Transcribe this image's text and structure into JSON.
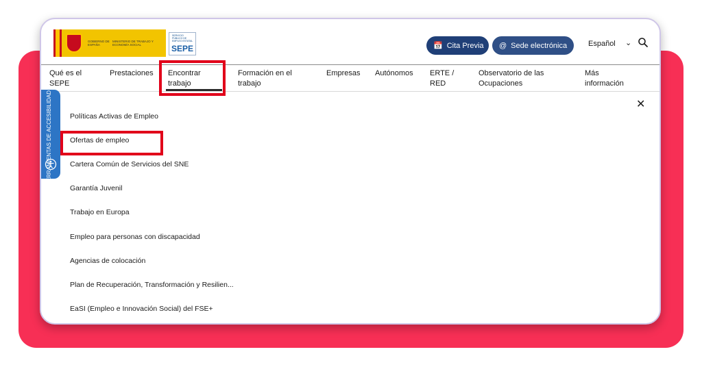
{
  "header": {
    "gov_text": "GOBIERNO DE ESPAÑA",
    "ministry_text": "MINISTERIO DE TRABAJO Y ECONOMÍA SOCIAL",
    "sepe_small": "SERVICIO PÚBLICO DE EMPLEO ESTATAL",
    "sepe_mark": "SEPE",
    "cita_label": "Cita Previa",
    "sede_label": "Sede electrónica",
    "language": "Español"
  },
  "nav": {
    "items": [
      {
        "line1": "Qué es el",
        "line2": "SEPE"
      },
      {
        "line1": "Prestaciones",
        "line2": ""
      },
      {
        "line1": "Encontrar",
        "line2": "trabajo"
      },
      {
        "line1": "Formación en el",
        "line2": "trabajo"
      },
      {
        "line1": "Empresas",
        "line2": ""
      },
      {
        "line1": "Autónomos",
        "line2": ""
      },
      {
        "line1": "ERTE /",
        "line2": "RED"
      },
      {
        "line1": "Observatorio de las",
        "line2": "Ocupaciones"
      },
      {
        "line1": "Más",
        "line2": "información"
      }
    ]
  },
  "accessibility_label": "HERRAMIENTAS DE ACCESIBILIDAD",
  "submenu": {
    "items": [
      "Políticas Activas de Empleo",
      "Ofertas de empleo",
      "Cartera Común de Servicios del SNE",
      "Garantía Juvenil",
      "Trabajo en Europa",
      "Empleo para personas con discapacidad",
      "Agencias de colocación",
      "Plan de Recuperación, Transformación y Resilien...",
      "EaSI (Empleo e Innovación Social) del FSE+"
    ]
  },
  "colors": {
    "backdrop": "#f72f55",
    "header_pill": "#1f3f77",
    "highlight": "#e1001a",
    "accessibility_tab": "#2d75c5"
  }
}
